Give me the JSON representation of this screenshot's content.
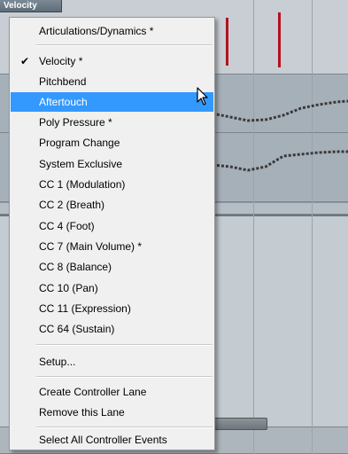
{
  "lane_tab": {
    "label": "Velocity"
  },
  "menu": {
    "items": [
      {
        "label": "Articulations/Dynamics *"
      },
      {
        "label": "Velocity *",
        "checked": true
      },
      {
        "label": "Pitchbend"
      },
      {
        "label": "Aftertouch",
        "highlighted": true
      },
      {
        "label": "Poly Pressure *"
      },
      {
        "label": "Program Change"
      },
      {
        "label": "System Exclusive"
      },
      {
        "label": "CC 1  (Modulation)"
      },
      {
        "label": "CC 2  (Breath)"
      },
      {
        "label": "CC 4  (Foot)"
      },
      {
        "label": "CC 7  (Main Volume) *"
      },
      {
        "label": "CC 8  (Balance)"
      },
      {
        "label": "CC 10  (Pan)"
      },
      {
        "label": "CC 11  (Expression)"
      },
      {
        "label": "CC 64  (Sustain)"
      },
      {
        "label": "Setup..."
      },
      {
        "label": "Create Controller Lane"
      },
      {
        "label": "Remove this Lane"
      },
      {
        "label": "Select All Controller Events"
      }
    ],
    "check_glyph": "✔",
    "highlight_color": "#3399ff"
  },
  "colors": {
    "velocity_bar": "#b3121f",
    "curve": "#3a3a3a"
  }
}
